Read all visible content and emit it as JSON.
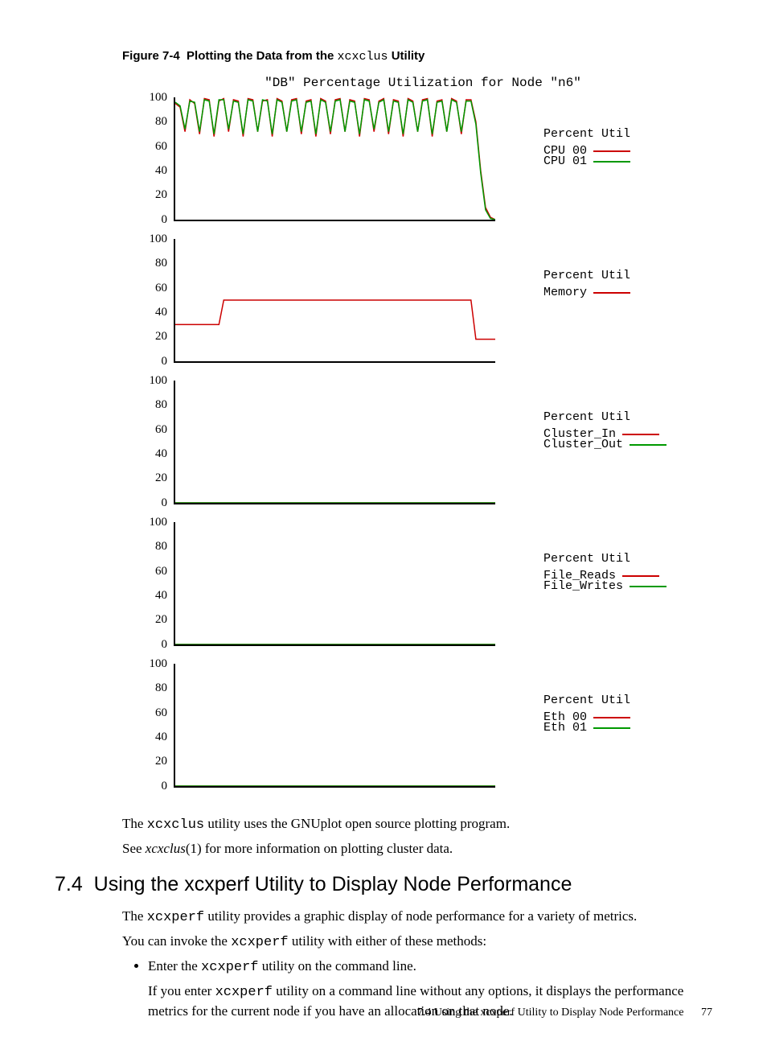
{
  "figure": {
    "label": "Figure 7-4",
    "title_pre": "Plotting the Data from the ",
    "mono": "xcxclus",
    "title_post": " Utility"
  },
  "chart_data": [
    {
      "type": "line",
      "title": "\"DB\" Percentage Utilization for Node \"n6\"",
      "ylim": [
        0,
        100
      ],
      "yticks": [
        0,
        20,
        40,
        60,
        80,
        100
      ],
      "legend_title": "Percent Util",
      "series": [
        {
          "name": "CPU 00",
          "color": "#cc0000",
          "values": [
            95,
            92,
            72,
            98,
            95,
            70,
            99,
            98,
            68,
            97,
            99,
            72,
            98,
            97,
            68,
            99,
            98,
            72,
            97,
            98,
            68,
            99,
            97,
            72,
            98,
            99,
            70,
            97,
            98,
            68,
            99,
            97,
            70,
            98,
            99,
            72,
            98,
            97,
            68,
            99,
            98,
            72,
            97,
            99,
            70,
            98,
            97,
            68,
            99,
            97,
            72,
            98,
            99,
            68,
            97,
            98,
            72,
            99,
            97,
            70,
            98,
            98,
            80,
            40,
            10,
            2,
            0
          ]
        },
        {
          "name": "CPU 01",
          "color": "#009900",
          "values": [
            96,
            93,
            74,
            97,
            96,
            72,
            98,
            97,
            70,
            98,
            98,
            74,
            97,
            96,
            70,
            98,
            97,
            72,
            98,
            97,
            70,
            98,
            96,
            72,
            97,
            98,
            72,
            96,
            97,
            70,
            98,
            96,
            72,
            97,
            98,
            72,
            97,
            96,
            70,
            98,
            97,
            74,
            96,
            98,
            72,
            97,
            96,
            70,
            98,
            96,
            72,
            97,
            98,
            70,
            96,
            97,
            72,
            98,
            96,
            72,
            97,
            97,
            78,
            38,
            8,
            1,
            0
          ]
        }
      ]
    },
    {
      "type": "line",
      "ylim": [
        0,
        100
      ],
      "yticks": [
        0,
        20,
        40,
        60,
        80,
        100
      ],
      "legend_title": "Percent Util",
      "series": [
        {
          "name": "Memory",
          "color": "#cc0000",
          "values": [
            30,
            30,
            30,
            30,
            30,
            30,
            30,
            30,
            30,
            30,
            50,
            50,
            50,
            50,
            50,
            50,
            50,
            50,
            50,
            50,
            50,
            50,
            50,
            50,
            50,
            50,
            50,
            50,
            50,
            50,
            50,
            50,
            50,
            50,
            50,
            50,
            50,
            50,
            50,
            50,
            50,
            50,
            50,
            50,
            50,
            50,
            50,
            50,
            50,
            50,
            50,
            50,
            50,
            50,
            50,
            50,
            50,
            50,
            50,
            50,
            50,
            50,
            18,
            18,
            18,
            18,
            18
          ]
        }
      ]
    },
    {
      "type": "line",
      "ylim": [
        0,
        100
      ],
      "yticks": [
        0,
        20,
        40,
        60,
        80,
        100
      ],
      "legend_title": "Percent Util",
      "series": [
        {
          "name": "Cluster_In",
          "color": "#cc0000",
          "values": [
            0,
            0,
            0,
            0,
            0,
            0,
            0,
            0,
            0,
            0,
            0,
            0,
            0,
            0,
            0,
            0,
            0,
            0,
            0,
            0,
            0,
            0,
            0,
            0,
            0,
            0,
            0,
            0,
            0,
            0,
            0,
            0,
            0,
            0,
            0,
            0,
            0,
            0,
            0,
            0,
            0,
            0,
            0,
            0,
            0,
            0,
            0,
            0,
            0,
            0,
            0,
            0,
            0,
            0,
            0,
            0,
            0,
            0,
            0,
            0,
            0,
            0,
            0,
            0,
            0,
            0,
            0
          ]
        },
        {
          "name": "Cluster_Out",
          "color": "#009900",
          "values": [
            0,
            0,
            0,
            0,
            0,
            0,
            0,
            0,
            0,
            0,
            0,
            0,
            0,
            0,
            0,
            0,
            0,
            0,
            0,
            0,
            0,
            0,
            0,
            0,
            0,
            0,
            0,
            0,
            0,
            0,
            0,
            0,
            0,
            0,
            0,
            0,
            0,
            0,
            0,
            0,
            0,
            0,
            0,
            0,
            0,
            0,
            0,
            0,
            0,
            0,
            0,
            0,
            0,
            0,
            0,
            0,
            0,
            0,
            0,
            0,
            0,
            0,
            0,
            0,
            0,
            0,
            0
          ]
        }
      ]
    },
    {
      "type": "line",
      "ylim": [
        0,
        100
      ],
      "yticks": [
        0,
        20,
        40,
        60,
        80,
        100
      ],
      "legend_title": "Percent Util",
      "series": [
        {
          "name": "File_Reads",
          "color": "#cc0000",
          "values": [
            0,
            0,
            0,
            0,
            0,
            0,
            0,
            0,
            0,
            0,
            0,
            0,
            0,
            0,
            0,
            0,
            0,
            0,
            0,
            0,
            0,
            0,
            0,
            0,
            0,
            0,
            0,
            0,
            0,
            0,
            0,
            0,
            0,
            0,
            0,
            0,
            0,
            0,
            0,
            0,
            0,
            0,
            0,
            0,
            0,
            0,
            0,
            0,
            0,
            0,
            0,
            0,
            0,
            0,
            0,
            0,
            0,
            0,
            0,
            0,
            0,
            0,
            0,
            0,
            0,
            0,
            0
          ]
        },
        {
          "name": "File_Writes",
          "color": "#009900",
          "values": [
            0,
            0,
            0,
            0,
            0,
            0,
            0,
            0,
            0,
            0,
            0,
            0,
            0,
            0,
            0,
            0,
            0,
            0,
            0,
            0,
            0,
            0,
            0,
            0,
            0,
            0,
            0,
            0,
            0,
            0,
            0,
            0,
            0,
            0,
            0,
            0,
            0,
            0,
            0,
            0,
            0,
            0,
            0,
            0,
            0,
            0,
            0,
            0,
            0,
            0,
            0,
            0,
            0,
            0,
            0,
            0,
            0,
            0,
            0,
            0,
            0,
            0,
            0,
            0,
            0,
            0,
            0
          ]
        }
      ]
    },
    {
      "type": "line",
      "ylim": [
        0,
        100
      ],
      "yticks": [
        0,
        20,
        40,
        60,
        80,
        100
      ],
      "legend_title": "Percent Util",
      "series": [
        {
          "name": "Eth 00",
          "color": "#cc0000",
          "values": [
            0,
            0,
            0,
            0,
            0,
            0,
            0,
            0,
            0,
            0,
            0,
            0,
            0,
            0,
            0,
            0,
            0,
            0,
            0,
            0,
            0,
            0,
            0,
            0,
            0,
            0,
            0,
            0,
            0,
            0,
            0,
            0,
            0,
            0,
            0,
            0,
            0,
            0,
            0,
            0,
            0,
            0,
            0,
            0,
            0,
            0,
            0,
            0,
            0,
            0,
            0,
            0,
            0,
            0,
            0,
            0,
            0,
            0,
            0,
            0,
            0,
            0,
            0,
            0,
            0,
            0,
            0
          ]
        },
        {
          "name": "Eth 01",
          "color": "#009900",
          "values": [
            0,
            0,
            0,
            0,
            0,
            0,
            0,
            0,
            0,
            0,
            0,
            0,
            0,
            0,
            0,
            0,
            0,
            0,
            0,
            0,
            0,
            0,
            0,
            0,
            0,
            0,
            0,
            0,
            0,
            0,
            0,
            0,
            0,
            0,
            0,
            0,
            0,
            0,
            0,
            0,
            0,
            0,
            0,
            0,
            0,
            0,
            0,
            0,
            0,
            0,
            0,
            0,
            0,
            0,
            0,
            0,
            0,
            0,
            0,
            0,
            0,
            0,
            0,
            0,
            0,
            0,
            0
          ]
        }
      ]
    }
  ],
  "paras": {
    "p1_pre": "The ",
    "p1_mono": "xcxclus",
    "p1_post": " utility uses the GNUplot open source plotting program.",
    "p2_pre": "See ",
    "p2_em": "xcxclus",
    "p2_post": "(1) for more information on plotting cluster data."
  },
  "section": {
    "num": "7.4",
    "title": "Using the xcxperf Utility to Display Node Performance"
  },
  "body": {
    "b1_pre": "The ",
    "b1_mono": "xcxperf",
    "b1_post": " utility provides a graphic display of node performance for a variety of metrics.",
    "b2_pre": "You can invoke the ",
    "b2_mono": "xcxperf",
    "b2_post": " utility with either of these methods:",
    "li1_pre": "Enter the ",
    "li1_mono": "xcxperf",
    "li1_post": " utility on the command line.",
    "li1b_pre": "If you enter ",
    "li1b_mono": "xcxperf",
    "li1b_post": " utility on a command line without any options, it displays the performance metrics for the current node if you have an allocation on that node."
  },
  "footer": {
    "text": "7.4 Using the xcxperf Utility to Display Node Performance",
    "page": "77"
  }
}
